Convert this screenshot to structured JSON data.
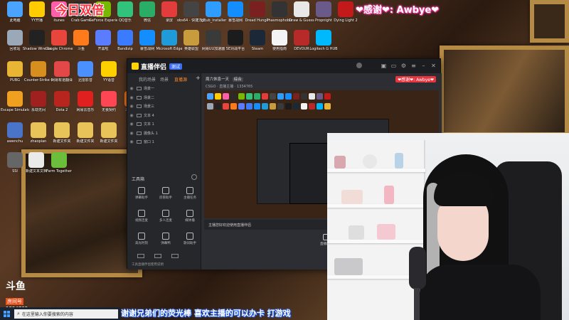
{
  "banner": {
    "left_text": "今日双倍",
    "right_text": "❤感谢❤: Awbye❤"
  },
  "desktop_icons": [
    {
      "label": "此电脑",
      "color": "#4aa3ff"
    },
    {
      "label": "YY开播",
      "color": "#ffcc00"
    },
    {
      "label": "itunes",
      "color": "#ff5fa8"
    },
    {
      "label": "Crab Game",
      "color": "#2a2a2a"
    },
    {
      "label": "GeForce Experience",
      "color": "#76b900"
    },
    {
      "label": "QQ音乐",
      "color": "#31c27c"
    },
    {
      "label": "微信",
      "color": "#2aae67"
    },
    {
      "label": "录屏",
      "color": "#e23c3c"
    },
    {
      "label": "obs64 - 快捷方式",
      "color": "#444"
    },
    {
      "label": "lghub_installer",
      "color": "#2f9cff"
    },
    {
      "label": "暴雪战网",
      "color": "#148eff"
    },
    {
      "label": "Dread Hunger",
      "color": "#7a2020"
    },
    {
      "label": "Phasmophobia",
      "color": "#333"
    },
    {
      "label": "Draw & Guess",
      "color": "#e8e8e8"
    },
    {
      "label": "Propnight",
      "color": "#6a5a8a"
    },
    {
      "label": "Dying Light 2",
      "color": "#c21a1a"
    },
    {
      "label": "回收站",
      "color": "#9aa8b8"
    },
    {
      "label": "Shadow Wire Sound",
      "color": "#222"
    },
    {
      "label": "Google Chrome",
      "color": "#e8453c"
    },
    {
      "label": "斗鱼",
      "color": "#ff7a1a"
    },
    {
      "label": "开黑啦",
      "color": "#5a7cff"
    },
    {
      "label": "Bandizip",
      "color": "#3b7bff"
    },
    {
      "label": "暴雪战网",
      "color": "#148eff"
    },
    {
      "label": "Microsoft Edge",
      "color": "#1e9bd8"
    },
    {
      "label": "英雄联盟",
      "color": "#c89b3c"
    },
    {
      "label": "网易UU加速器",
      "color": "#3a3a3a"
    },
    {
      "label": "5E对战平台",
      "color": "#1c1c1c"
    },
    {
      "label": "Steam",
      "color": "#1b2838"
    },
    {
      "label": "使用指南",
      "color": "#f4f4f4"
    },
    {
      "label": "DEVOUR",
      "color": "#b82a2a"
    },
    {
      "label": "Logitech G HUB",
      "color": "#00b8fc"
    },
    {
      "label": "PUBG",
      "color": "#e8b634"
    },
    {
      "label": "Counter-Strike Global Offensive",
      "color": "#d68f1e"
    },
    {
      "label": "网易有道翻译",
      "color": "#e34848"
    },
    {
      "label": "迅雷影音",
      "color": "#4a90ff"
    },
    {
      "label": "YY语音",
      "color": "#ffd000"
    },
    {
      "label": "Escape Simulator",
      "color": "#f0a020"
    },
    {
      "label": "永劫无间",
      "color": "#a02020"
    },
    {
      "label": "Dota 2",
      "color": "#b8251f"
    },
    {
      "label": "网易云音乐",
      "color": "#e0201f"
    },
    {
      "label": "无畏契约",
      "color": "#ff4655"
    },
    {
      "label": "斗鱼直播",
      "color": "#ff7a1a"
    },
    {
      "label": "awenchu",
      "color": "#4a74c8"
    },
    {
      "label": "zhaopian",
      "color": "#e7c35a"
    },
    {
      "label": "新建文件夹",
      "color": "#e7c35a"
    },
    {
      "label": "新建文件夹",
      "color": "#e7c35a"
    },
    {
      "label": "新建文件夹",
      "color": "#e7c35a"
    },
    {
      "label": "SSI",
      "color": "#666"
    },
    {
      "label": "新建文本文档",
      "color": "#eaeaea"
    },
    {
      "label": "Farm Together",
      "color": "#6cbf3a"
    }
  ],
  "app": {
    "logo_text": "直播伴侣",
    "version_badge": "测试",
    "left_tabs": [
      "我的场景",
      "场景",
      "直播源"
    ],
    "scenes": [
      "场景一",
      "场景二",
      "场景三",
      "文本 4",
      "文本 1",
      "摄像头 1",
      "窗口 1"
    ],
    "tools_title": "工具箱",
    "tools": [
      "弹幕助手",
      "房管助手",
      "主播任务",
      "视频连麦",
      "多人连麦",
      "媒体播",
      "高光时刻",
      "弹幕鸭",
      "歌词助手"
    ],
    "stream_title": "周六休息一天",
    "stream_tag": "综合",
    "stream_sub": "CSGO · 直播主播 · 1334765",
    "notice": "主播您好欢迎使用直播伴侣",
    "bottom_buttons": [
      "直播屏幕",
      "摄像头",
      "手机投屏",
      "多媒体"
    ],
    "footer_text": "工具直播伴侣使用说明"
  },
  "overlay": {
    "room_logo": "斗鱼",
    "room_label": "房间号",
    "room_id": "1334765",
    "marquee": "谢谢兄弟们的荧光棒 喜欢主播的可以办卡 打游戏"
  },
  "taskbar": {
    "search_placeholder": "在这里输入你要搜索的内容"
  }
}
